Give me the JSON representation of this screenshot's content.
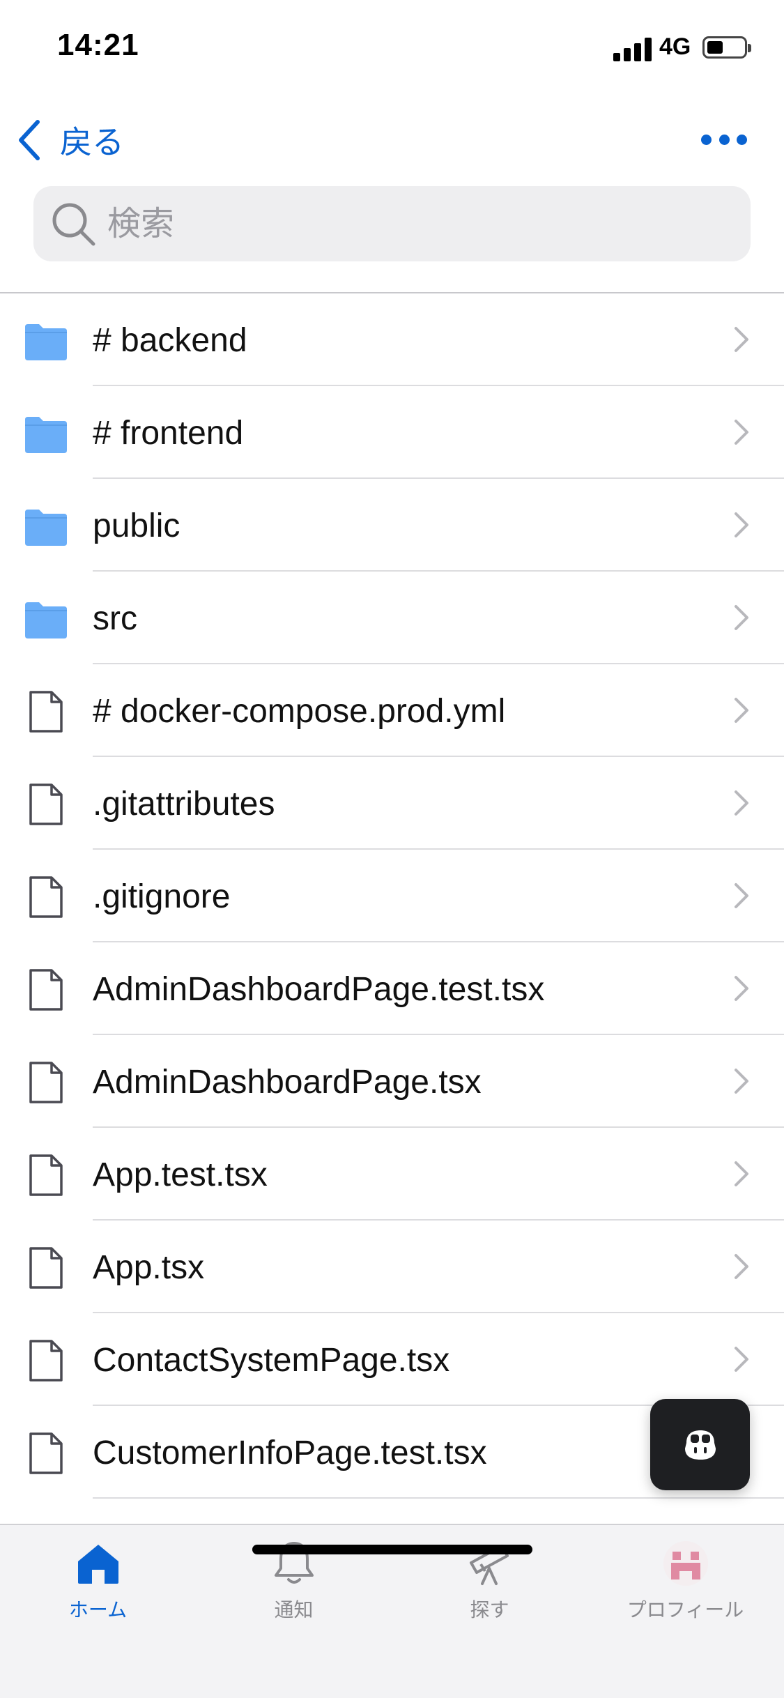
{
  "status_bar": {
    "time": "14:21",
    "network": "4G",
    "signal_icon": "cellular-signal-icon",
    "battery_icon": "battery-icon",
    "battery_level": 0.4
  },
  "nav": {
    "back_label": "戻る",
    "back_icon": "chevron-left-icon",
    "more_icon": "ellipsis-icon"
  },
  "search": {
    "placeholder": "検索",
    "value": "",
    "icon": "search-icon"
  },
  "files": [
    {
      "name": "# backend",
      "type": "folder"
    },
    {
      "name": "# frontend",
      "type": "folder"
    },
    {
      "name": "public",
      "type": "folder"
    },
    {
      "name": "src",
      "type": "folder"
    },
    {
      "name": "# docker-compose.prod.yml",
      "type": "file"
    },
    {
      "name": ".gitattributes",
      "type": "file"
    },
    {
      "name": ".gitignore",
      "type": "file"
    },
    {
      "name": "AdminDashboardPage.test.tsx",
      "type": "file"
    },
    {
      "name": "AdminDashboardPage.tsx",
      "type": "file"
    },
    {
      "name": "App.test.tsx",
      "type": "file"
    },
    {
      "name": "App.tsx",
      "type": "file"
    },
    {
      "name": "ContactSystemPage.tsx",
      "type": "file"
    },
    {
      "name": "CustomerInfoPage.test.tsx",
      "type": "file"
    }
  ],
  "fab": {
    "icon": "copilot-icon"
  },
  "tabs": [
    {
      "label": "ホーム",
      "icon": "home-icon",
      "active": true
    },
    {
      "label": "通知",
      "icon": "bell-icon",
      "active": false
    },
    {
      "label": "探す",
      "icon": "telescope-icon",
      "active": false
    },
    {
      "label": "プロフィール",
      "icon": "avatar-icon",
      "active": false
    }
  ],
  "colors": {
    "accent": "#0a63d1",
    "folder": "#6aaef8",
    "background": "#ffffff",
    "tabbar": "#f3f3f5"
  }
}
